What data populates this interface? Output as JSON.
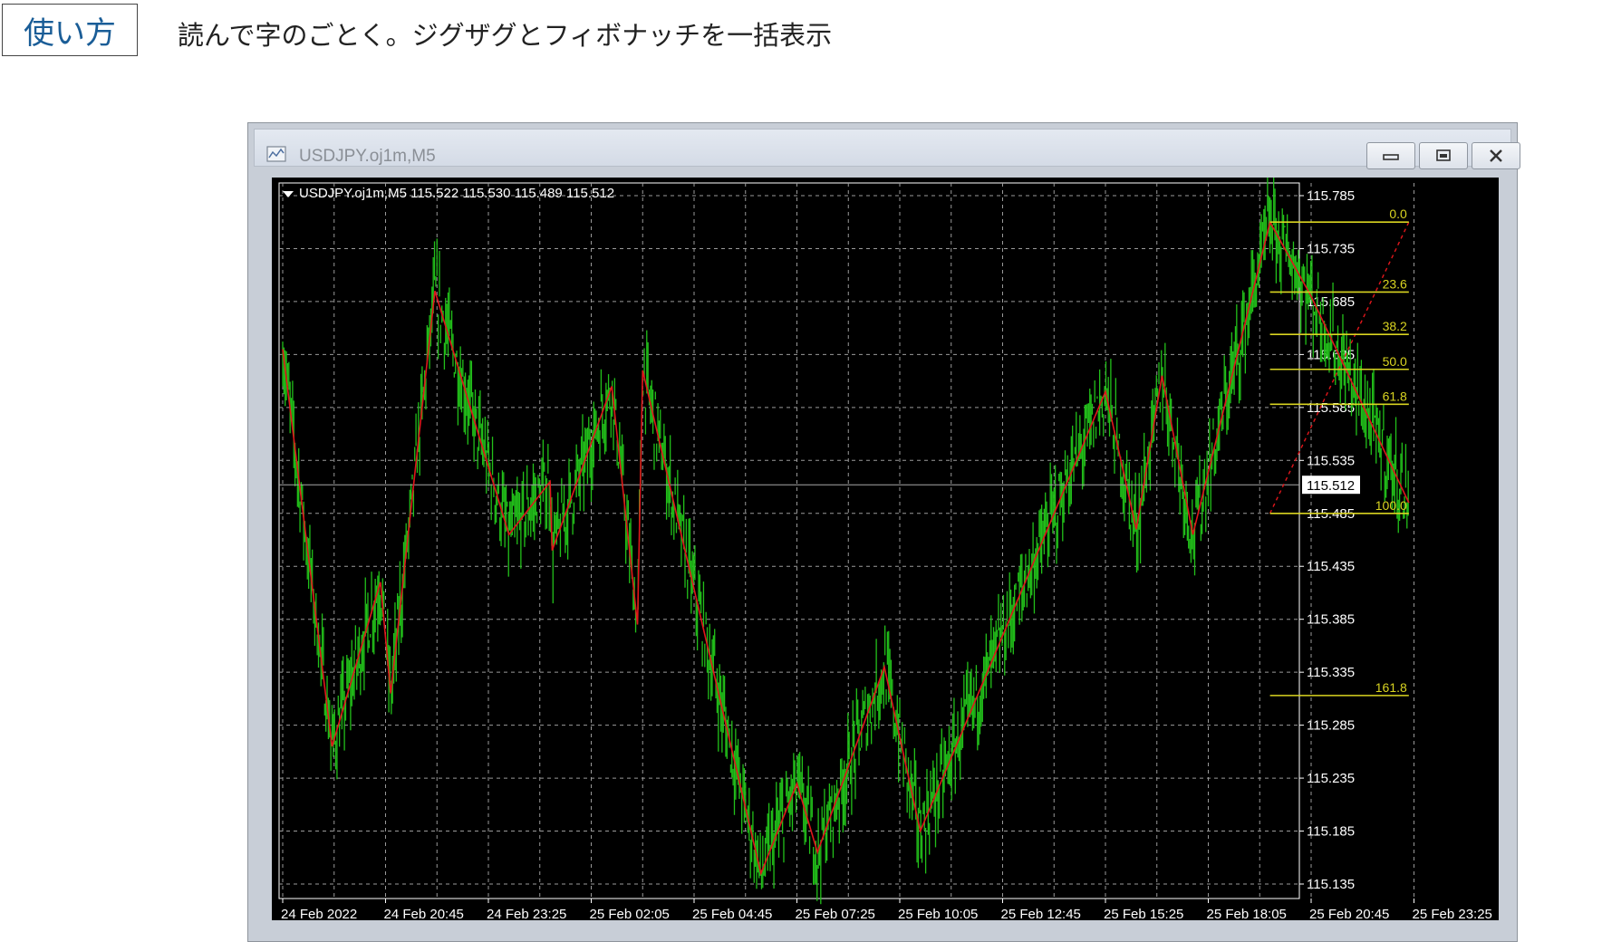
{
  "header": {
    "tab_label": "使い方",
    "description": "読んで字のごとく。ジグザグとフィボナッチを一括表示"
  },
  "window": {
    "title": "USDJPY.oj1m,M5",
    "buttons": [
      "minimize",
      "maximize",
      "close"
    ]
  },
  "chart": {
    "info_line": "USDJPY.oj1m,M5  115.522 115.530 115.489 115.512",
    "current_price_label": "115.512"
  },
  "colors": {
    "background": "#000000",
    "candles": "#22c01a",
    "zigzag": "#e0161b",
    "fibo": "#d9d421",
    "grid": "#9a9a9a",
    "axis_text": "#ffffff",
    "header_tab_text": "#1a5d97"
  },
  "chart_data": {
    "type": "line",
    "symbol": "USDJPY.oj1m",
    "timeframe": "M5",
    "ohlc_current": {
      "open": 115.522,
      "high": 115.53,
      "low": 115.489,
      "close": 115.512
    },
    "y_ticks": [
      115.785,
      115.735,
      115.685,
      115.635,
      115.585,
      115.535,
      115.485,
      115.435,
      115.385,
      115.335,
      115.285,
      115.235,
      115.185,
      115.135
    ],
    "ylim": [
      115.135,
      115.785
    ],
    "x_ticks": [
      "24 Feb 2022",
      "24 Feb 20:45",
      "24 Feb 23:25",
      "25 Feb 02:05",
      "25 Feb 04:45",
      "25 Feb 07:25",
      "25 Feb 10:05",
      "25 Feb 12:45",
      "25 Feb 15:25",
      "25 Feb 18:05",
      "25 Feb 20:45",
      "25 Feb 23:25"
    ],
    "current_price": 115.512,
    "zigzag": [
      {
        "x": 0.0,
        "y": 115.64
      },
      {
        "x": 0.48,
        "y": 115.265
      },
      {
        "x": 0.95,
        "y": 115.42
      },
      {
        "x": 1.05,
        "y": 115.315
      },
      {
        "x": 1.48,
        "y": 115.695
      },
      {
        "x": 2.2,
        "y": 115.465
      },
      {
        "x": 2.6,
        "y": 115.515
      },
      {
        "x": 2.62,
        "y": 115.45
      },
      {
        "x": 3.2,
        "y": 115.605
      },
      {
        "x": 3.45,
        "y": 115.38
      },
      {
        "x": 3.5,
        "y": 115.62
      },
      {
        "x": 4.65,
        "y": 115.145
      },
      {
        "x": 5.0,
        "y": 115.23
      },
      {
        "x": 5.2,
        "y": 115.165
      },
      {
        "x": 5.85,
        "y": 115.34
      },
      {
        "x": 6.2,
        "y": 115.185
      },
      {
        "x": 8.0,
        "y": 115.6
      },
      {
        "x": 8.3,
        "y": 115.47
      },
      {
        "x": 8.55,
        "y": 115.615
      },
      {
        "x": 8.85,
        "y": 115.465
      },
      {
        "x": 9.6,
        "y": 115.76
      },
      {
        "x": 10.0,
        "y": 115.69
      },
      {
        "x": 10.95,
        "y": 115.495
      }
    ],
    "fibonacci": {
      "levels": [
        {
          "label": "0.0",
          "price": 115.76
        },
        {
          "label": "23.6",
          "price": 115.694
        },
        {
          "label": "38.2",
          "price": 115.654
        },
        {
          "label": "50.0",
          "price": 115.621
        },
        {
          "label": "61.8",
          "price": 115.588
        },
        {
          "label": "100.0",
          "price": 115.485
        },
        {
          "label": "161.8",
          "price": 115.313
        }
      ]
    }
  }
}
